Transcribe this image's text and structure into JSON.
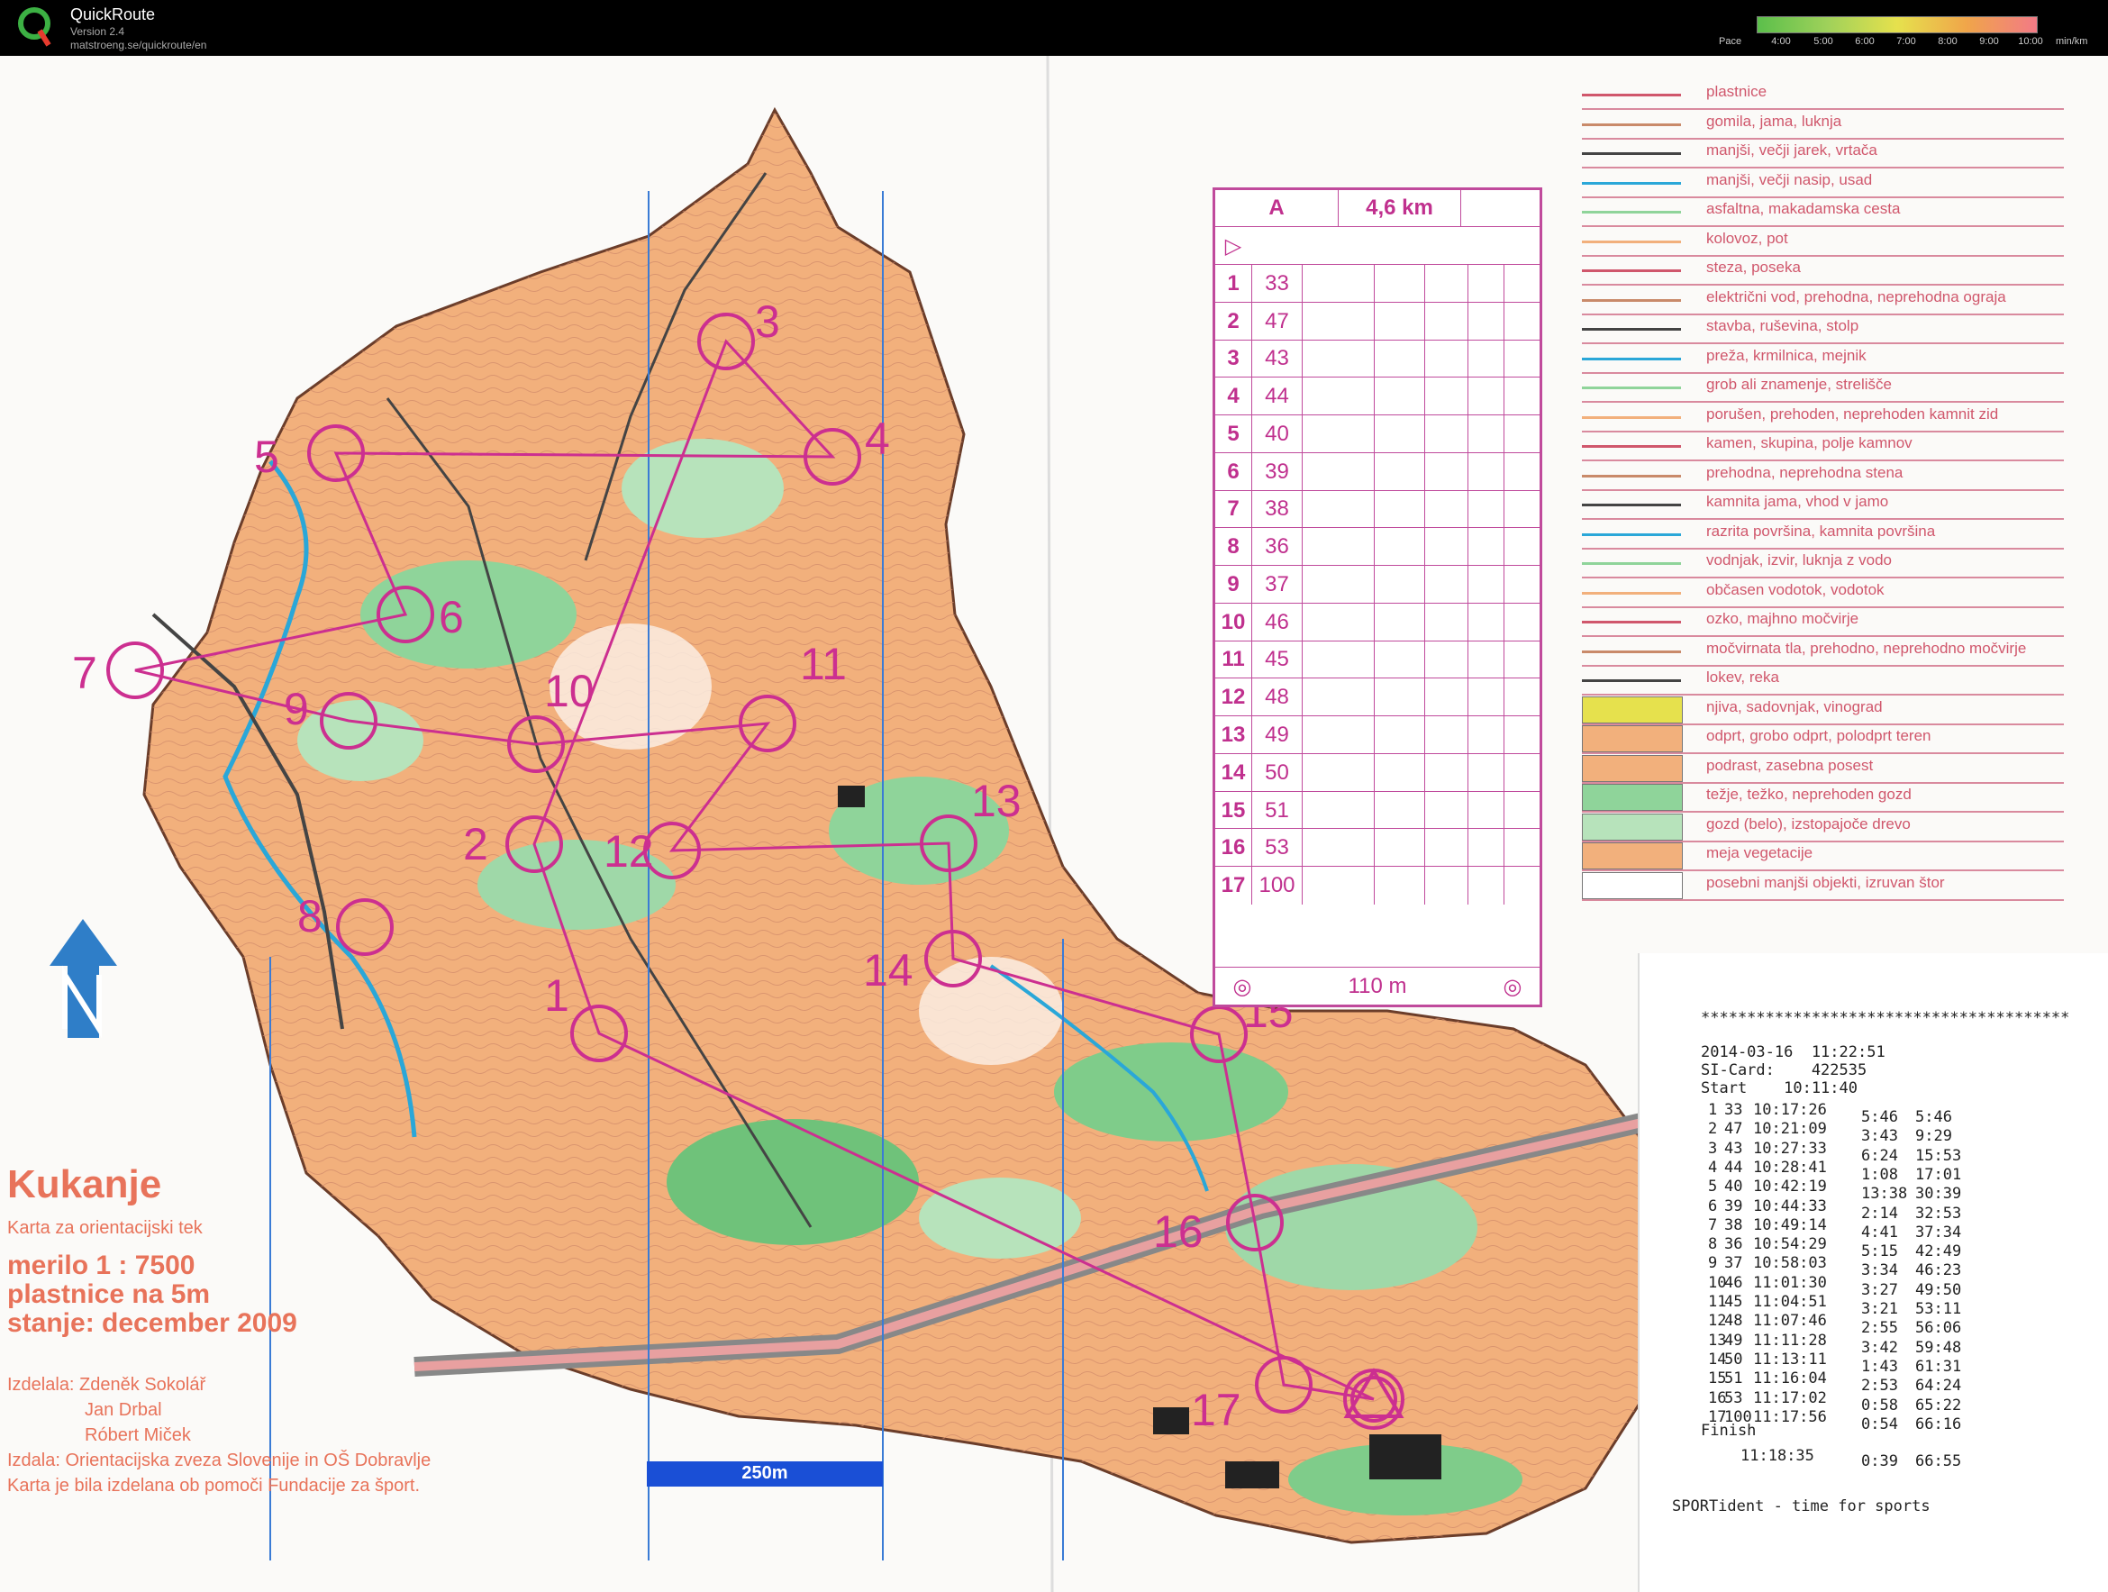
{
  "app": {
    "title": "QuickRoute",
    "version": "Version 2.4",
    "url": "matstroeng.se/quickroute/en"
  },
  "pace_scale": {
    "label": "Pace",
    "ticks": [
      "4:00",
      "5:00",
      "6:00",
      "7:00",
      "8:00",
      "9:00",
      "10:00"
    ],
    "unit": "min/km",
    "colors": [
      "#5bbf4b",
      "#9fd15a",
      "#e6e14d",
      "#f0a54a",
      "#f27a86"
    ]
  },
  "map": {
    "title": "Kukanje",
    "subtitle": "Karta za orientacijski tek",
    "scale": "merilo 1 : 7500",
    "contours": "plastnice na 5m",
    "state": "stanje: december 2009",
    "authors_label": "Izdelala: Zdeněk Sokolář",
    "author2": "Jan Drbal",
    "author3": "Róbert Miček",
    "publisher": "Izdala: Orientacijska zveza Slovenije in OŠ Dobravlje",
    "funding": "Karta je bila izdelana ob pomoči Fundacije za šport.",
    "scalebar_label": "250m",
    "controls": [
      "2",
      "3",
      "4",
      "5",
      "6",
      "7",
      "8",
      "9",
      "10",
      "11",
      "12",
      "13",
      "14",
      "15",
      "16",
      "17",
      "1"
    ]
  },
  "description": {
    "class": "A",
    "length": "4,6 km",
    "rows": [
      {
        "n": "1",
        "code": "33"
      },
      {
        "n": "2",
        "code": "47"
      },
      {
        "n": "3",
        "code": "43"
      },
      {
        "n": "4",
        "code": "44"
      },
      {
        "n": "5",
        "code": "40"
      },
      {
        "n": "6",
        "code": "39"
      },
      {
        "n": "7",
        "code": "38"
      },
      {
        "n": "8",
        "code": "36"
      },
      {
        "n": "9",
        "code": "37"
      },
      {
        "n": "10",
        "code": "46"
      },
      {
        "n": "11",
        "code": "45"
      },
      {
        "n": "12",
        "code": "48"
      },
      {
        "n": "13",
        "code": "49"
      },
      {
        "n": "14",
        "code": "50"
      },
      {
        "n": "15",
        "code": "51"
      },
      {
        "n": "16",
        "code": "53"
      },
      {
        "n": "17",
        "code": "100"
      }
    ],
    "finish": "110 m"
  },
  "legend": [
    "plastnice",
    "gomila, jama, luknja",
    "manjši, večji jarek, vrtača",
    "manjši, večji nasip, usad",
    "asfaltna, makadamska cesta",
    "kolovoz, pot",
    "steza, poseka",
    "električni vod, prehodna, neprehodna ograja",
    "stavba, ruševina, stolp",
    "preža, krmilnica, mejnik",
    "grob ali znamenje, strelišče",
    "porušen, prehoden, neprehoden kamnit zid",
    "kamen, skupina, polje kamnov",
    "prehodna, neprehodna stena",
    "kamnita jama, vhod v jamo",
    "razrita površina, kamnita površina",
    "vodnjak, izvir, luknja z vodo",
    "občasen vodotok, vodotok",
    "ozko, majhno močvirje",
    "močvirnata tla, prehodno, neprehodno močvirje",
    "lokev, reka",
    "njiva, sadovnjak, vinograd",
    "odprt, grobo odprt, polodprt teren",
    "podrast, zasebna posest",
    "težje, težko, neprehoden gozd",
    "gozd (belo), izstopajoče drevo",
    "meja vegetacije",
    "posebni manjši objekti, izruvan štor"
  ],
  "receipt": {
    "stars": "****************************************",
    "date": "2014-03-16  11:22:51",
    "card": "SI-Card:    422535",
    "start": "Start    10:11:40",
    "splits": [
      {
        "n": "1",
        "code": "33",
        "time": "10:17:26",
        "leg": "5:46",
        "total": "5:46"
      },
      {
        "n": "2",
        "code": "47",
        "time": "10:21:09",
        "leg": "3:43",
        "total": "9:29"
      },
      {
        "n": "3",
        "code": "43",
        "time": "10:27:33",
        "leg": "6:24",
        "total": "15:53"
      },
      {
        "n": "4",
        "code": "44",
        "time": "10:28:41",
        "leg": "1:08",
        "total": "17:01"
      },
      {
        "n": "5",
        "code": "40",
        "time": "10:42:19",
        "leg": "13:38",
        "total": "30:39"
      },
      {
        "n": "6",
        "code": "39",
        "time": "10:44:33",
        "leg": "2:14",
        "total": "32:53"
      },
      {
        "n": "7",
        "code": "38",
        "time": "10:49:14",
        "leg": "4:41",
        "total": "37:34"
      },
      {
        "n": "8",
        "code": "36",
        "time": "10:54:29",
        "leg": "5:15",
        "total": "42:49"
      },
      {
        "n": "9",
        "code": "37",
        "time": "10:58:03",
        "leg": "3:34",
        "total": "46:23"
      },
      {
        "n": "10",
        "code": "46",
        "time": "11:01:30",
        "leg": "3:27",
        "total": "49:50"
      },
      {
        "n": "11",
        "code": "45",
        "time": "11:04:51",
        "leg": "3:21",
        "total": "53:11"
      },
      {
        "n": "12",
        "code": "48",
        "time": "11:07:46",
        "leg": "2:55",
        "total": "56:06"
      },
      {
        "n": "13",
        "code": "49",
        "time": "11:11:28",
        "leg": "3:42",
        "total": "59:48"
      },
      {
        "n": "14",
        "code": "50",
        "time": "11:13:11",
        "leg": "1:43",
        "total": "61:31"
      },
      {
        "n": "15",
        "code": "51",
        "time": "11:16:04",
        "leg": "2:53",
        "total": "64:24"
      },
      {
        "n": "16",
        "code": "53",
        "time": "11:17:02",
        "leg": "0:58",
        "total": "65:22"
      },
      {
        "n": "17",
        "code": "100",
        "time": "11:17:56",
        "leg": "0:54",
        "total": "66:16"
      }
    ],
    "finish_label": "Finish",
    "finish_time": "11:18:35",
    "finish_leg": "0:39",
    "finish_total": "66:55",
    "footer": "SPORTident - time for sports"
  }
}
